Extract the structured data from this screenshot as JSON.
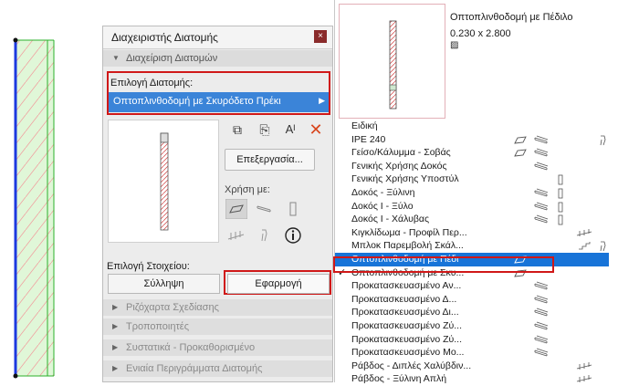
{
  "dialog": {
    "title": "Διαχειριστής Διατομής",
    "close_label": "×",
    "section_manage": "Διαχείριση Διατομών",
    "select_label": "Επιλογή Διατομής:",
    "selected_profile": "Οπτοπλινθοδομή με Σκυρόδετο Πρέκι",
    "edit_label": "Επεξεργασία...",
    "usage_label": "Χρήση με:",
    "element_label": "Επιλογή Στοιχείου:",
    "collect_label": "Σύλληψη",
    "apply_label": "Εφαρμογή",
    "collapsed_sections": [
      "Ριζόχαρτα Σχεδίασης",
      "Τροποποιητές",
      "Συστατικά - Προκαθορισμένο",
      "Ενιαία Περιγράμματα Διατομής"
    ]
  },
  "preview_panel": {
    "name": "Οπτοπλινθοδομή με Πέδιλο",
    "size": "0.230 x 2.800"
  },
  "profile_list": [
    {
      "label": "Ειδική",
      "icons": []
    },
    {
      "label": "IPE 240",
      "icons": [
        "wall-icon",
        "beam-icon",
        "object-icon"
      ]
    },
    {
      "label": "Γείσο/Κάλυμμα - Σοβάς",
      "icons": [
        "wall-icon",
        "beam-icon"
      ]
    },
    {
      "label": "Γενικής Χρήσης Δοκός",
      "icons": [
        "beam-icon"
      ]
    },
    {
      "label": "Γενικής Χρήσης Υποστύλ",
      "icons": [
        "column-icon"
      ]
    },
    {
      "label": "Δοκός - Ξύλινη",
      "icons": [
        "beam-icon",
        "column-icon"
      ]
    },
    {
      "label": "Δοκός I - Ξύλο",
      "icons": [
        "beam-icon",
        "column-icon"
      ]
    },
    {
      "label": "Δοκός I - Χάλυβας",
      "icons": [
        "beam-icon",
        "column-icon"
      ]
    },
    {
      "label": "Κιγκλίδωμα - Προφίλ Περ...",
      "icons": [
        "railing-icon"
      ]
    },
    {
      "label": "Μπλοκ Παρεμβολή Σκάλ...",
      "icons": [
        "stair-icon",
        "object-icon"
      ]
    },
    {
      "label": "Οπτοπλινθοδομή με Πέδι",
      "icons": [
        "wall-icon"
      ],
      "selected": true
    },
    {
      "label": "Οπτοπλινθοδομή με Σκυ...",
      "icons": [
        "wall-icon"
      ],
      "checked": true
    },
    {
      "label": "Προκατασκευασμένο Αν...",
      "icons": [
        "beam-icon"
      ]
    },
    {
      "label": "Προκατασκευασμένο Δ...",
      "icons": [
        "beam-icon"
      ]
    },
    {
      "label": "Προκατασκευασμένο Δι...",
      "icons": [
        "beam-icon"
      ]
    },
    {
      "label": "Προκατασκευασμένο Ζύ...",
      "icons": [
        "beam-icon"
      ]
    },
    {
      "label": "Προκατασκευασμένο Ζύ...",
      "icons": [
        "beam-icon"
      ]
    },
    {
      "label": "Προκατασκευασμένο Μο...",
      "icons": [
        "beam-icon"
      ]
    },
    {
      "label": "Ράβδος - Διπλές Χαλύβδιν...",
      "icons": [
        "railing-icon"
      ]
    },
    {
      "label": "Ράβδος - Ξύλινη Απλή",
      "icons": [
        "railing-icon"
      ]
    }
  ],
  "colors": {
    "accent": "#1874d8",
    "highlight": "#d01818",
    "hatch": "#d04040",
    "wall_fill": "#d9f5d0",
    "wall_edge": "#1a37d8"
  }
}
